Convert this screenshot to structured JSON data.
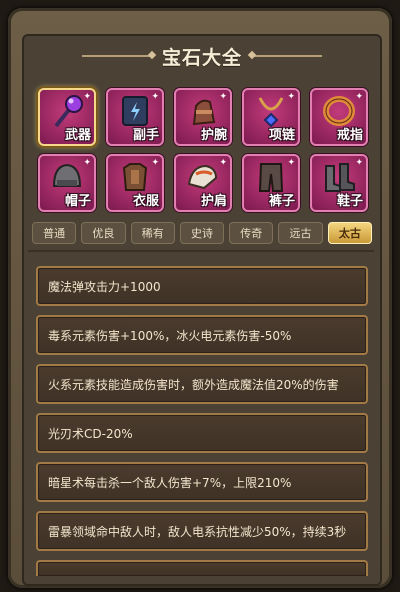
{
  "title": "宝石大全",
  "slots": [
    {
      "label": "武器",
      "icon": "staff-orb-icon",
      "selected": true
    },
    {
      "label": "副手",
      "icon": "spellbook-icon",
      "selected": false
    },
    {
      "label": "护腕",
      "icon": "bracer-icon",
      "selected": false
    },
    {
      "label": "项链",
      "icon": "necklace-icon",
      "selected": false
    },
    {
      "label": "戒指",
      "icon": "ring-icon",
      "selected": false
    },
    {
      "label": "帽子",
      "icon": "helmet-icon",
      "selected": false
    },
    {
      "label": "衣服",
      "icon": "armor-icon",
      "selected": false
    },
    {
      "label": "护肩",
      "icon": "shoulder-pad-icon",
      "selected": false
    },
    {
      "label": "裤子",
      "icon": "pants-icon",
      "selected": false
    },
    {
      "label": "鞋子",
      "icon": "boots-icon",
      "selected": false
    }
  ],
  "tabs": [
    "普通",
    "优良",
    "稀有",
    "史诗",
    "传奇",
    "远古",
    "太古"
  ],
  "active_tab": "太古",
  "effects": [
    "魔法弹攻击力+1000",
    "毒系元素伤害+100%，冰火电元素伤害-50%",
    "火系元素技能造成伤害时，额外造成魔法值20%的伤害",
    "光刃术CD-20%",
    "暗星术每击杀一个敌人伤害+7%，上限210%",
    "雷暴领域命中敌人时，敌人电系抗性减少50%，持续3秒"
  ],
  "colors": {
    "slot": "#b12e6c",
    "accent": "#f4d57e",
    "row_border": "#a27a45"
  }
}
